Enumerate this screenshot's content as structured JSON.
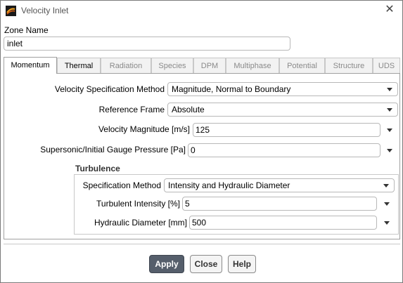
{
  "window": {
    "title": "Velocity Inlet",
    "icon": "ansys-fluent-icon",
    "close_glyph": "✕"
  },
  "zone": {
    "label": "Zone Name",
    "value": "inlet"
  },
  "tabs": [
    {
      "label": "Momentum",
      "active": true
    },
    {
      "label": "Thermal",
      "active": false
    },
    {
      "label": "Radiation",
      "active": false
    },
    {
      "label": "Species",
      "active": false
    },
    {
      "label": "DPM",
      "active": false
    },
    {
      "label": "Multiphase",
      "active": false
    },
    {
      "label": "Potential",
      "active": false
    },
    {
      "label": "Structure",
      "active": false
    },
    {
      "label": "UDS",
      "active": false
    }
  ],
  "momentum": {
    "velocity_spec_label": "Velocity Specification Method",
    "velocity_spec_value": "Magnitude, Normal to Boundary",
    "reference_frame_label": "Reference Frame",
    "reference_frame_value": "Absolute",
    "velocity_magnitude_label": "Velocity Magnitude [m/s]",
    "velocity_magnitude_value": "125",
    "pressure_label": "Supersonic/Initial Gauge Pressure [Pa]",
    "pressure_value": "0"
  },
  "turbulence": {
    "section_title": "Turbulence",
    "spec_method_label": "Specification Method",
    "spec_method_value": "Intensity and Hydraulic Diameter",
    "intensity_label": "Turbulent Intensity [%]",
    "intensity_value": "5",
    "hydraulic_diameter_label": "Hydraulic Diameter [mm]",
    "hydraulic_diameter_value": "500"
  },
  "buttons": {
    "apply": "Apply",
    "close": "Close",
    "help": "Help"
  },
  "colors": {
    "primary_button": "#555e6b",
    "border": "#b8b8b8"
  }
}
